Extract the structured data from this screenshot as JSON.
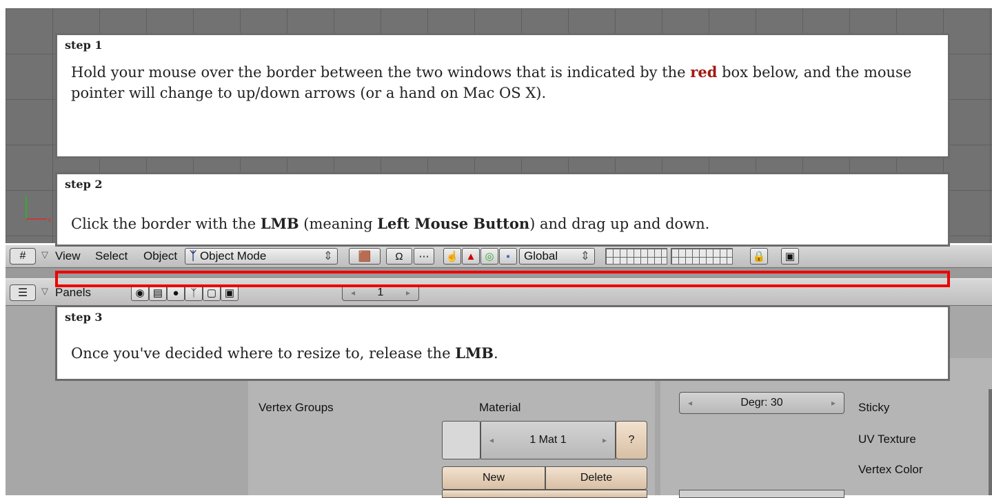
{
  "header1": {
    "menus": [
      "View",
      "Select",
      "Object"
    ],
    "mode": "Object Mode",
    "orientation": "Global"
  },
  "header2": {
    "menu": "Panels",
    "page": "1"
  },
  "buttons": {
    "vertex_groups": "Vertex Groups",
    "material": "Material",
    "mat_field": "1 Mat 1",
    "question": "?",
    "new": "New",
    "delete": "Delete",
    "degr": "Degr: 30",
    "sticky": "Sticky",
    "uv_texture": "UV Texture",
    "vertex_color": "Vertex Color"
  },
  "steps": [
    {
      "title": "step 1",
      "text_before": "Hold your mouse over the border between the two windows that is indicated by the ",
      "highlight": "red",
      "text_after": " box below, and the mouse pointer will change to up/down arrows (or a hand on Mac OS X)."
    },
    {
      "title": "step 2",
      "text_a": "Click the border with the ",
      "bold_a": "LMB",
      "text_b": " (meaning ",
      "bold_b": "Left Mouse Button",
      "text_c": ") and drag up and down."
    },
    {
      "title": "step 3",
      "text_a": "Once you've decided where to resize to, release the ",
      "bold_a": "LMB",
      "text_b": "."
    }
  ],
  "colors": {
    "highlight_border": "#ee0000",
    "highlight_text": "#a11a12",
    "viewport_bg": "#727272",
    "button_tan": "#e6cfb6"
  }
}
